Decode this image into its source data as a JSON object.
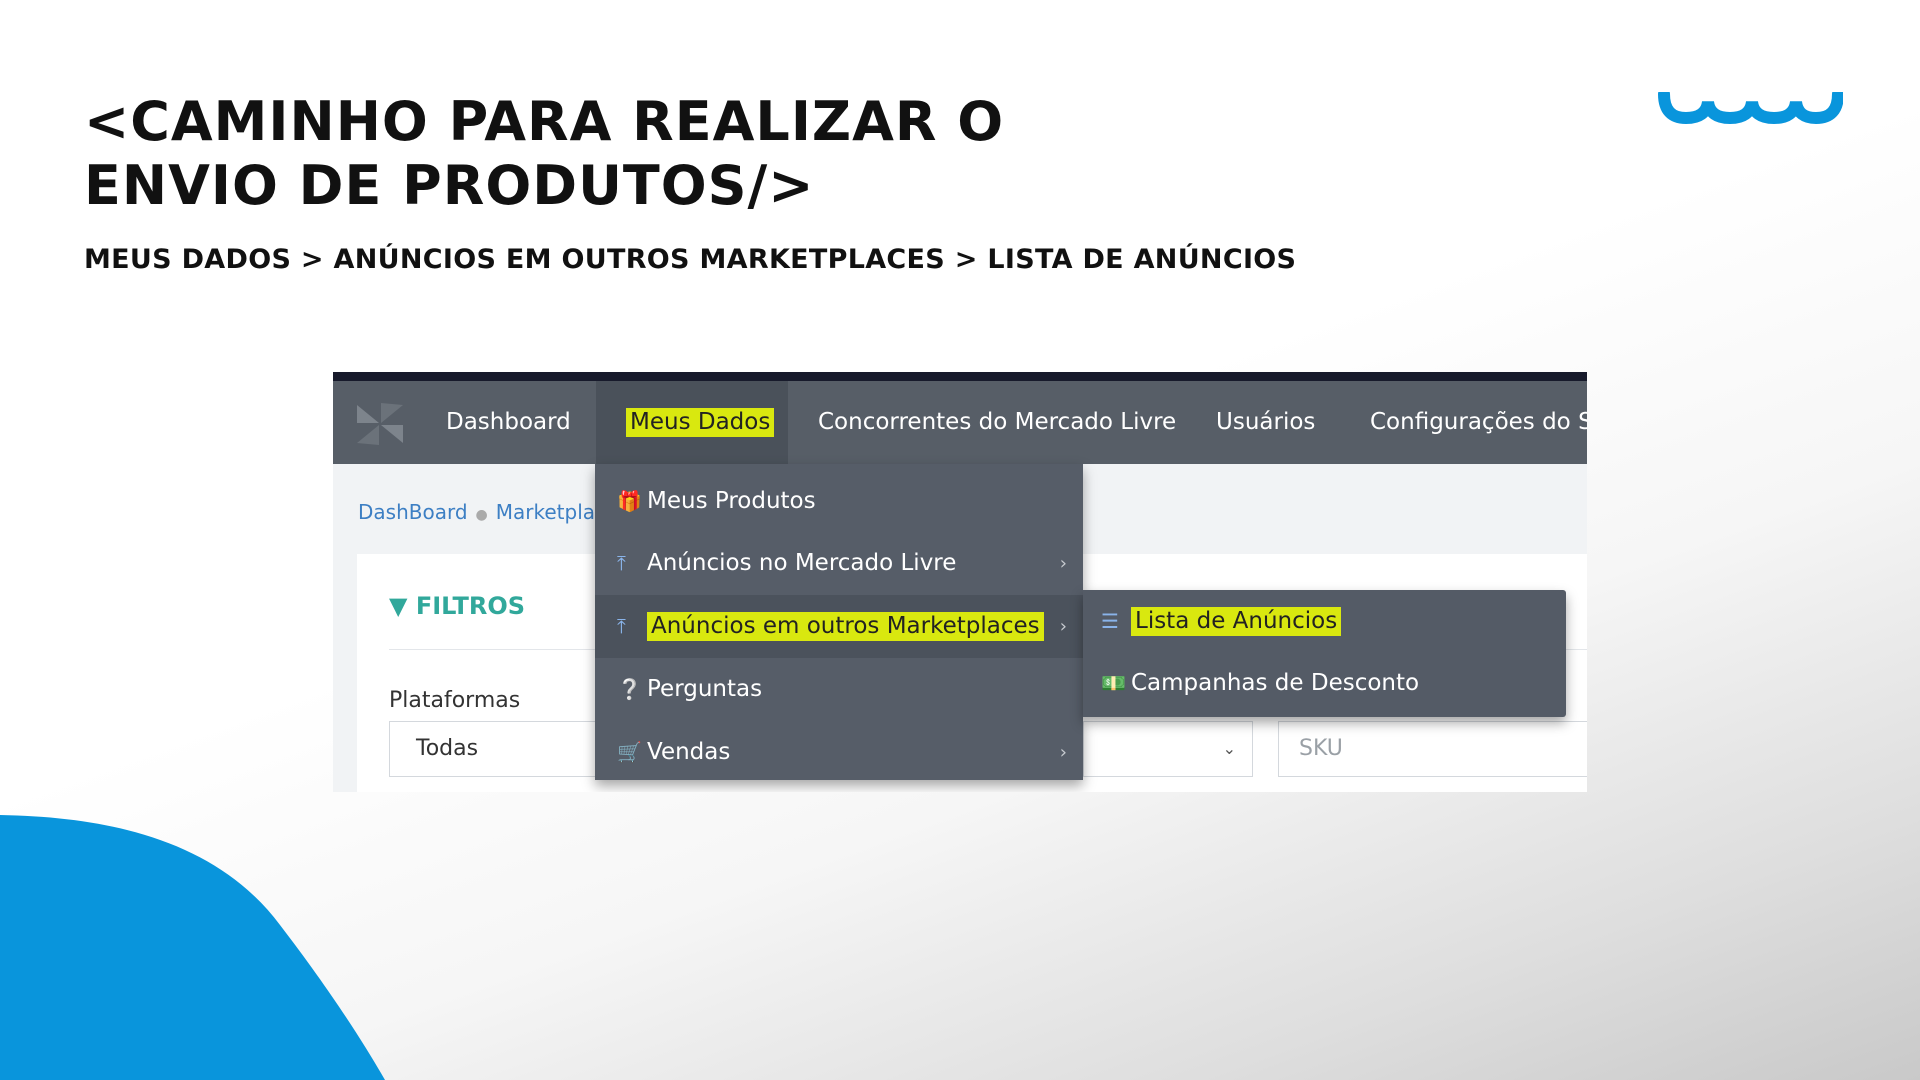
{
  "slide": {
    "title_line1": "<CAMINHO PARA REALIZAR O",
    "title_line2": "ENVIO DE PRODUTOS/>",
    "subtitle": "MEUS DADOS > ANÚNCIOS EM OUTROS MARKETPLACES > LISTA DE ANÚNCIOS",
    "accent_color": "#0995dc",
    "logo_icon": "wave-logo-icon"
  },
  "app": {
    "nav": {
      "logo_icon": "pinwheel-logo-icon",
      "items": [
        {
          "label": "Dashboard"
        },
        {
          "label": "Meus Dados",
          "active": true,
          "highlighted": true
        },
        {
          "label": "Concorrentes do Mercado Livre"
        },
        {
          "label": "Usuários"
        },
        {
          "label": "Configurações do Si"
        }
      ]
    },
    "breadcrumb": [
      "DashBoard",
      "Marketpla"
    ],
    "filters": {
      "title": "FILTROS",
      "platforms_label": "Plataformas",
      "platforms_value": "Todas",
      "sku_placeholder": "SKU"
    },
    "dropdown": {
      "items": [
        {
          "label": "Meus Produtos",
          "icon": "gift-icon",
          "has_submenu": false
        },
        {
          "label": "Anúncios no Mercado Livre",
          "icon": "upload-icon",
          "has_submenu": true
        },
        {
          "label": "Anúncios em outros Marketplaces",
          "icon": "upload-icon",
          "has_submenu": true,
          "selected": true,
          "highlighted": true
        },
        {
          "label": "Perguntas",
          "icon": "question-circle-icon",
          "has_submenu": false
        },
        {
          "label": "Vendas",
          "icon": "cart-icon",
          "has_submenu": true
        }
      ]
    },
    "submenu": {
      "items": [
        {
          "label": "Lista de Anúncios",
          "icon": "list-icon",
          "highlighted": true
        },
        {
          "label": "Campanhas de Desconto",
          "icon": "money-icon"
        }
      ]
    },
    "colors": {
      "navbar": "#575e67",
      "highlight": "#d9e80f",
      "filters_title": "#31a89b",
      "link": "#3d7fc4"
    }
  }
}
